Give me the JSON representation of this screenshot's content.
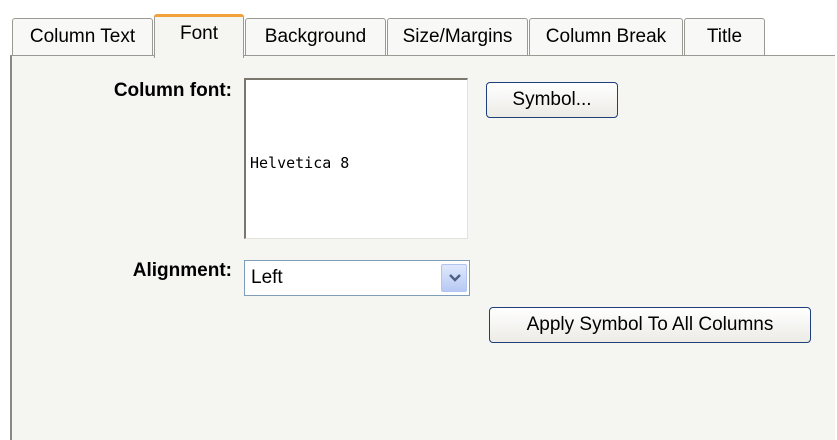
{
  "tabs": [
    {
      "label": "Column Text",
      "active": false
    },
    {
      "label": "Font",
      "active": true
    },
    {
      "label": "Background",
      "active": false
    },
    {
      "label": "Size/Margins",
      "active": false
    },
    {
      "label": "Column Break",
      "active": false
    },
    {
      "label": "Title",
      "active": false
    }
  ],
  "form": {
    "column_font_label": "Column font:",
    "column_font_value": "Helvetica 8",
    "symbol_button": "Symbol...",
    "alignment_label": "Alignment:",
    "alignment_value": "Left",
    "apply_button": "Apply Symbol To All Columns"
  },
  "icons": {
    "dropdown": "chevron-down-icon"
  },
  "colors": {
    "active_tab_accent": "#f2a23a",
    "button_border": "#1f3f7a",
    "panel_background": "#f5f5f2"
  }
}
